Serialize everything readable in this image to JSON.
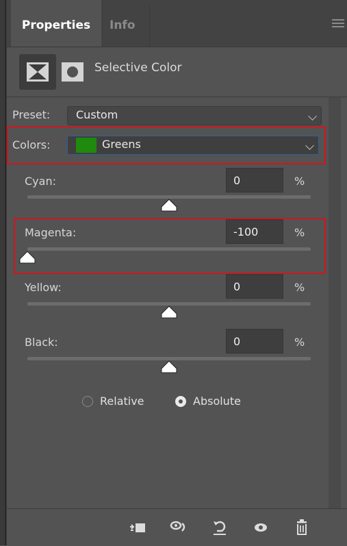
{
  "tabs": [
    {
      "label": "Properties",
      "active": true
    },
    {
      "label": "Info",
      "active": false
    }
  ],
  "header": {
    "title": "Selective Color"
  },
  "preset": {
    "label": "Preset:",
    "value": "Custom"
  },
  "colors": {
    "label": "Colors:",
    "value": "Greens",
    "swatch_color": "#1f8a0e"
  },
  "sliders": [
    {
      "label": "Cyan:",
      "value": "0",
      "unit": "%",
      "level_percent": 0
    },
    {
      "label": "Magenta:",
      "value": "-100",
      "unit": "%",
      "level_percent": -100
    },
    {
      "label": "Yellow:",
      "value": "0",
      "unit": "%",
      "level_percent": 0
    },
    {
      "label": "Black:",
      "value": "0",
      "unit": "%",
      "level_percent": 0
    }
  ],
  "method": {
    "options": [
      {
        "label": "Relative",
        "selected": false
      },
      {
        "label": "Absolute",
        "selected": true
      }
    ]
  },
  "footer_icons": [
    "clip-to-layer-icon",
    "view-previous-state-icon",
    "reset-icon",
    "visibility-icon",
    "trash-icon"
  ],
  "accent_colors": {
    "highlight": "#d0161c",
    "focus": "#2f5f9f"
  }
}
